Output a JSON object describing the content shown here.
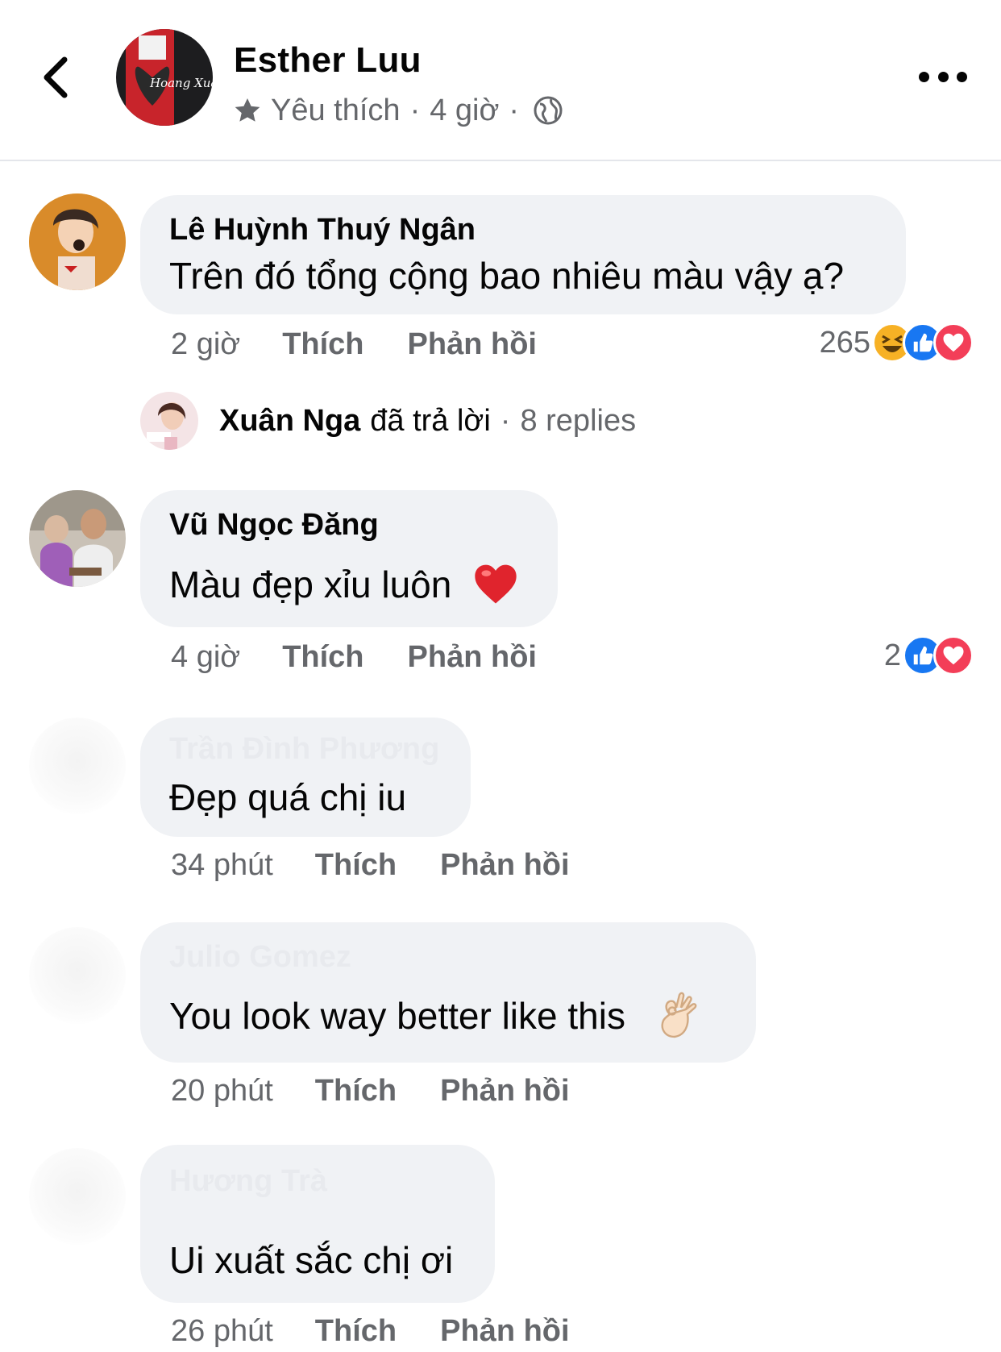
{
  "header": {
    "name": "Esther Luu",
    "meta_favorite": "Yêu thích",
    "meta_sep1": "·",
    "meta_time": "4 giờ",
    "meta_sep2": "·",
    "back_icon": "chevron-left-icon",
    "more_icon": "more-horizontal-icon",
    "avatar_text": "Hoang Xuan"
  },
  "comments": [
    {
      "name": "Lê Huỳnh Thuý Ngân",
      "text": "Trên đó tổng cộng bao nhiêu màu vậy ạ?",
      "time": "2 giờ",
      "like": "Thích",
      "reply": "Phản hồi",
      "reaction_count": "265",
      "reactions": [
        "haha",
        "like",
        "love"
      ]
    },
    {
      "name": "Vũ Ngọc Đăng",
      "text": "Màu đẹp xỉu luôn",
      "emoji": "❤️",
      "time": "4 giờ",
      "like": "Thích",
      "reply": "Phản hồi",
      "reaction_count": "2",
      "reactions": [
        "like",
        "love"
      ]
    },
    {
      "name": "Trần Đình Phương",
      "text": "Đẹp quá chị iu",
      "time": "34 phút",
      "like": "Thích",
      "reply": "Phản hồi"
    },
    {
      "name": "Julio Gomez",
      "text": "You look way better like this",
      "emoji": "👌",
      "time": "20 phút",
      "like": "Thích",
      "reply": "Phản hồi"
    },
    {
      "name": "Hương Trà",
      "text": "Ui xuất sắc chị ơi",
      "time": "26 phút",
      "like": "Thích",
      "reply": "Phản hồi"
    }
  ],
  "reply_summary": {
    "name": "Xuân Nga",
    "verb": "đã trả lời",
    "sep": "·",
    "count": "8 replies"
  },
  "colors": {
    "bubble": "#f0f2f5",
    "secondary_text": "#65676b",
    "like_blue": "#1877f2",
    "love_red": "#f33e58",
    "haha_yellow": "#f7b125"
  }
}
